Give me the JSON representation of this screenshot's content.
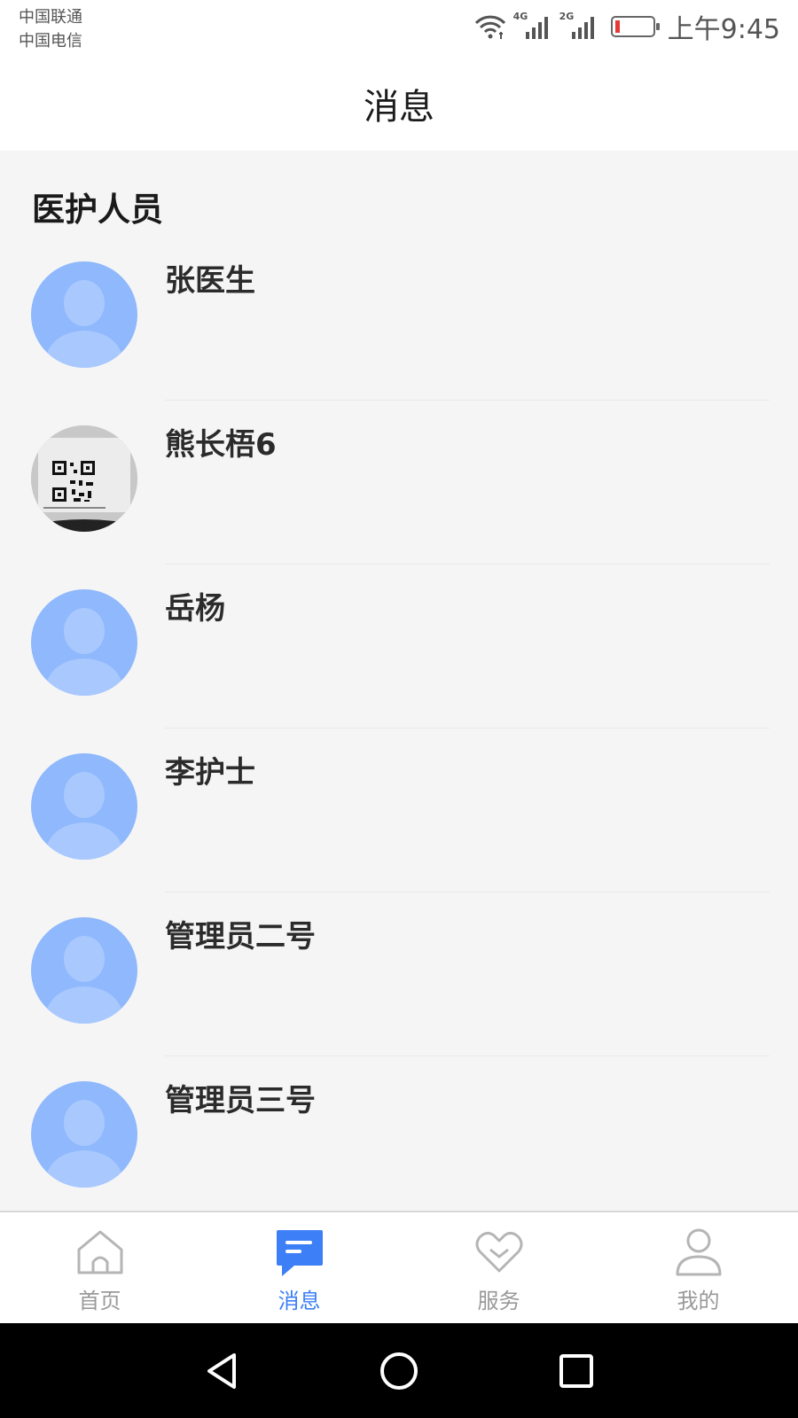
{
  "status_bar": {
    "carriers": [
      "中国联通",
      "中国电信"
    ],
    "signals": [
      {
        "tag": "4G"
      },
      {
        "tag": "2G"
      }
    ],
    "battery_color": "#e53935",
    "time": "上午9:45"
  },
  "header": {
    "title": "消息"
  },
  "section": {
    "title": "医护人员"
  },
  "contacts": [
    {
      "name": "张医生",
      "avatar": "default-avatar"
    },
    {
      "name": "熊长梧6",
      "avatar": "qr-code-photo"
    },
    {
      "name": "岳杨",
      "avatar": "default-avatar"
    },
    {
      "name": "李护士",
      "avatar": "default-avatar"
    },
    {
      "name": "管理员二号",
      "avatar": "default-avatar"
    },
    {
      "name": "管理员三号",
      "avatar": "default-avatar"
    }
  ],
  "tabbar": {
    "active_color": "#3d7ff6",
    "inactive_color": "#999999",
    "tabs": [
      {
        "label": "首页",
        "icon": "home-icon",
        "active": false
      },
      {
        "label": "消息",
        "icon": "message-icon",
        "active": true
      },
      {
        "label": "服务",
        "icon": "heart-icon",
        "active": false
      },
      {
        "label": "我的",
        "icon": "person-icon",
        "active": false
      }
    ]
  },
  "nav_bar": {
    "buttons": [
      "back-icon",
      "home-circle-icon",
      "recents-icon"
    ]
  }
}
